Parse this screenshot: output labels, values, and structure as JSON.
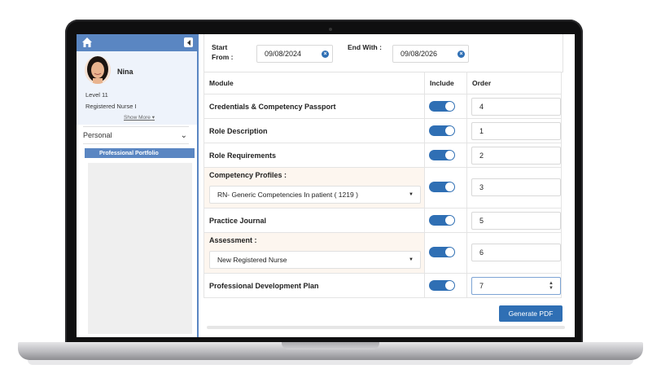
{
  "sidebar": {
    "user_name": "Nina",
    "level": "Level 11",
    "role": "Registered Nurse I",
    "show_more": "Show More",
    "dropdown_value": "Personal",
    "active_item": "Professional Portfolio"
  },
  "dates": {
    "start_label": "Start From :",
    "start_value": "09/08/2024",
    "end_label": "End With :",
    "end_value": "09/08/2026"
  },
  "table": {
    "headers": {
      "module": "Module",
      "include": "Include",
      "order": "Order"
    },
    "rows": [
      {
        "module": "Credentials & Competency Passport",
        "include": true,
        "order": "4"
      },
      {
        "module": "Role Description",
        "include": true,
        "order": "1"
      },
      {
        "module": "Role Requirements",
        "include": true,
        "order": "2"
      },
      {
        "module": "Competency Profiles :",
        "select": "RN- Generic Competencies In patient ( 1219 )",
        "include": true,
        "order": "3"
      },
      {
        "module": "Practice Journal",
        "include": true,
        "order": "5"
      },
      {
        "module": "Assessment :",
        "select": "New Registered Nurse",
        "include": true,
        "order": "6"
      },
      {
        "module": "Professional Development Plan",
        "include": true,
        "order": "7"
      }
    ]
  },
  "actions": {
    "generate_pdf": "Generate PDF"
  },
  "colors": {
    "accent": "#2f6fb4",
    "sidebar_blue": "#5a86c2",
    "highlight_row": "#fdf6ef"
  }
}
